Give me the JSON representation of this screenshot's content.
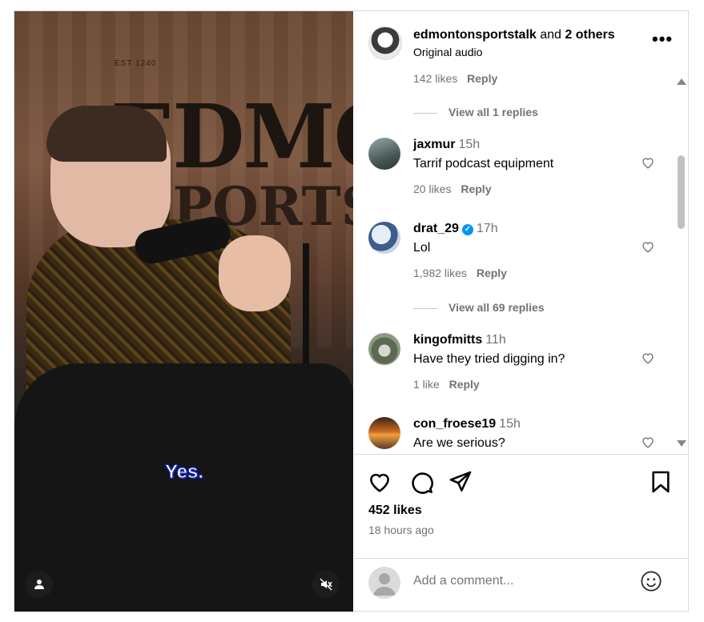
{
  "video": {
    "caption": "Yes.",
    "wall_text_1": "EDMONT",
    "wall_text_2": "SPORTS T",
    "wall_sign": "EST 1240"
  },
  "header": {
    "author_name": "edmontonsportstalk",
    "author_suffix_connector": "and",
    "author_suffix_others": "2 others",
    "subtitle": "Original audio",
    "more_label": "•••"
  },
  "comments": {
    "top_meta": {
      "likes": "142 likes",
      "reply": "Reply"
    },
    "view_replies_1": "View all 1 replies",
    "items": [
      {
        "user": "jaxmur",
        "time": "15h",
        "text": "Tarrif podcast equipment",
        "likes": "20 likes",
        "reply": "Reply",
        "verified": false
      },
      {
        "user": "drat_29",
        "time": "17h",
        "text": "Lol",
        "likes": "1,982 likes",
        "reply": "Reply",
        "verified": true
      },
      {
        "user": "kingofmitts",
        "time": "11h",
        "text": "Have they tried digging in?",
        "likes": "1 like",
        "reply": "Reply",
        "verified": false
      },
      {
        "user": "con_froese19",
        "time": "15h",
        "text": "Are we serious?",
        "likes": "",
        "reply": "",
        "verified": false
      }
    ],
    "view_replies_2": "View all 69 replies"
  },
  "actions": {
    "likes": "452 likes",
    "time_ago": "18 hours ago"
  },
  "composer": {
    "placeholder": "Add a comment..."
  },
  "colors": {
    "muted_text": "#737373",
    "border": "#dbdbdb",
    "verified": "#0095f6",
    "caption_stroke": "#1a2cc4"
  }
}
